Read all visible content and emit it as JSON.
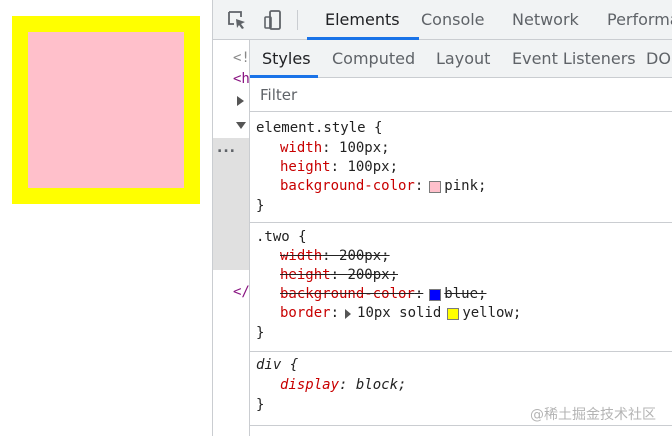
{
  "devtools": {
    "tabs": [
      "Elements",
      "Console",
      "Network",
      "Performa"
    ],
    "subtabs": [
      "Styles",
      "Computed",
      "Layout",
      "Event Listeners",
      "DOI"
    ],
    "filter_placeholder": "Filter",
    "dom_fragments": [
      "<!",
      "<h",
      "</"
    ],
    "dom_ellipsis": "..."
  },
  "styles": {
    "element_style": {
      "selector": "element.style {",
      "width": {
        "prop": "width",
        "value": "100px;"
      },
      "height": {
        "prop": "height",
        "value": "100px;"
      },
      "bg": {
        "prop": "background-color",
        "value": "pink;",
        "swatch": "#ffc0cb"
      },
      "close": "}"
    },
    "two": {
      "selector": ".two {",
      "width": {
        "prop": "width",
        "value": "200px;"
      },
      "height": {
        "prop": "height",
        "value": "200px;"
      },
      "bg": {
        "prop": "background-color",
        "value": "blue;",
        "swatch": "#0000ff"
      },
      "border": {
        "prop": "border",
        "value_pre": "10px solid",
        "value": "yellow;",
        "swatch": "#ffff00"
      },
      "close": "}"
    },
    "div": {
      "selector": "div {",
      "display": {
        "prop": "display",
        "value": "block;"
      },
      "close": "}"
    }
  },
  "preview": {
    "content_color": "#ffc0cb",
    "border_color": "#ffff00"
  },
  "accent_color": "#1a73e8",
  "watermark": "@稀土掘金技术社区"
}
